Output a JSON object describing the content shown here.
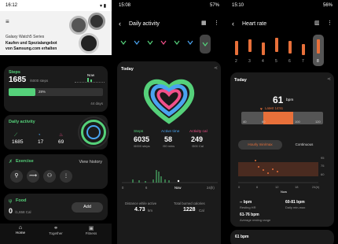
{
  "screen1": {
    "status": {
      "time": "16:12"
    },
    "promo": {
      "line1": "Galaxy Watch5 Series",
      "line2": "Kaufen und Spezialangebot",
      "line3": "von Samsung.com erhalten"
    },
    "steps": {
      "title": "Steps",
      "value": "1685",
      "goal": "/6000 steps",
      "now": "Now",
      "progress_text": "28%",
      "progress": 0.28,
      "days": "44 days"
    },
    "activity": {
      "title": "Daily activity",
      "v1": "1685",
      "v2": "17",
      "v3": "69"
    },
    "exercise": {
      "title": "Exercise",
      "link": "View history"
    },
    "food": {
      "title": "Food",
      "value": "0",
      "unit": "/1,658 Cal",
      "add": "Add"
    },
    "nav": {
      "home": "Home",
      "together": "Together",
      "fitness": "Fitness"
    }
  },
  "screen2": {
    "status": {
      "time": "15:08",
      "battery": "57%"
    },
    "title": "Daily activity",
    "section": "Today",
    "stats": [
      {
        "label": "Steps",
        "value": "6035",
        "sub": "/6000 steps",
        "color": "#55d17a"
      },
      {
        "label": "Active time",
        "value": "58",
        "sub": "/90 mins",
        "color": "#4aa3f0"
      },
      {
        "label": "Activity cal",
        "value": "249",
        "sub": "/500 Cal",
        "color": "#f2508a"
      }
    ],
    "axis": {
      "a": "0",
      "b": "6",
      "c": "Now",
      "d": "24(h)"
    },
    "distance": {
      "label": "Distance while active",
      "value": "4.73",
      "unit": "km"
    },
    "calories": {
      "label": "Total burned calories",
      "value": "1228",
      "unit": "Cal"
    },
    "colors": {
      "green": "#55d17a",
      "blue": "#4aa3f0",
      "pink": "#f2508a"
    }
  },
  "screen3": {
    "status": {
      "time": "15:10",
      "battery": "56%"
    },
    "title": "Heart rate",
    "section": "Today",
    "bpm": "61",
    "bpm_unit": "bpm",
    "latest": "Latest 14:51",
    "scale": {
      "a": "40",
      "b": "60",
      "c": "100",
      "d": "120"
    },
    "toggle": {
      "left": "Hourly min/max",
      "right": "Continuous"
    },
    "yticks": {
      "a": "95",
      "b": "75",
      "c": "60"
    },
    "axis": {
      "a": "0",
      "b": "6",
      "c": "12",
      "d": "18",
      "e": "24(h)",
      "now": "Now"
    },
    "resting": {
      "value": "-- bpm",
      "label": "Resting HR",
      "range": "61-76 bpm",
      "range_label": "Average resting range"
    },
    "daily": {
      "value": "60-81 bpm",
      "label": "Daily min-max"
    },
    "partial": "61 bpm",
    "accent": "#e8703a"
  }
}
